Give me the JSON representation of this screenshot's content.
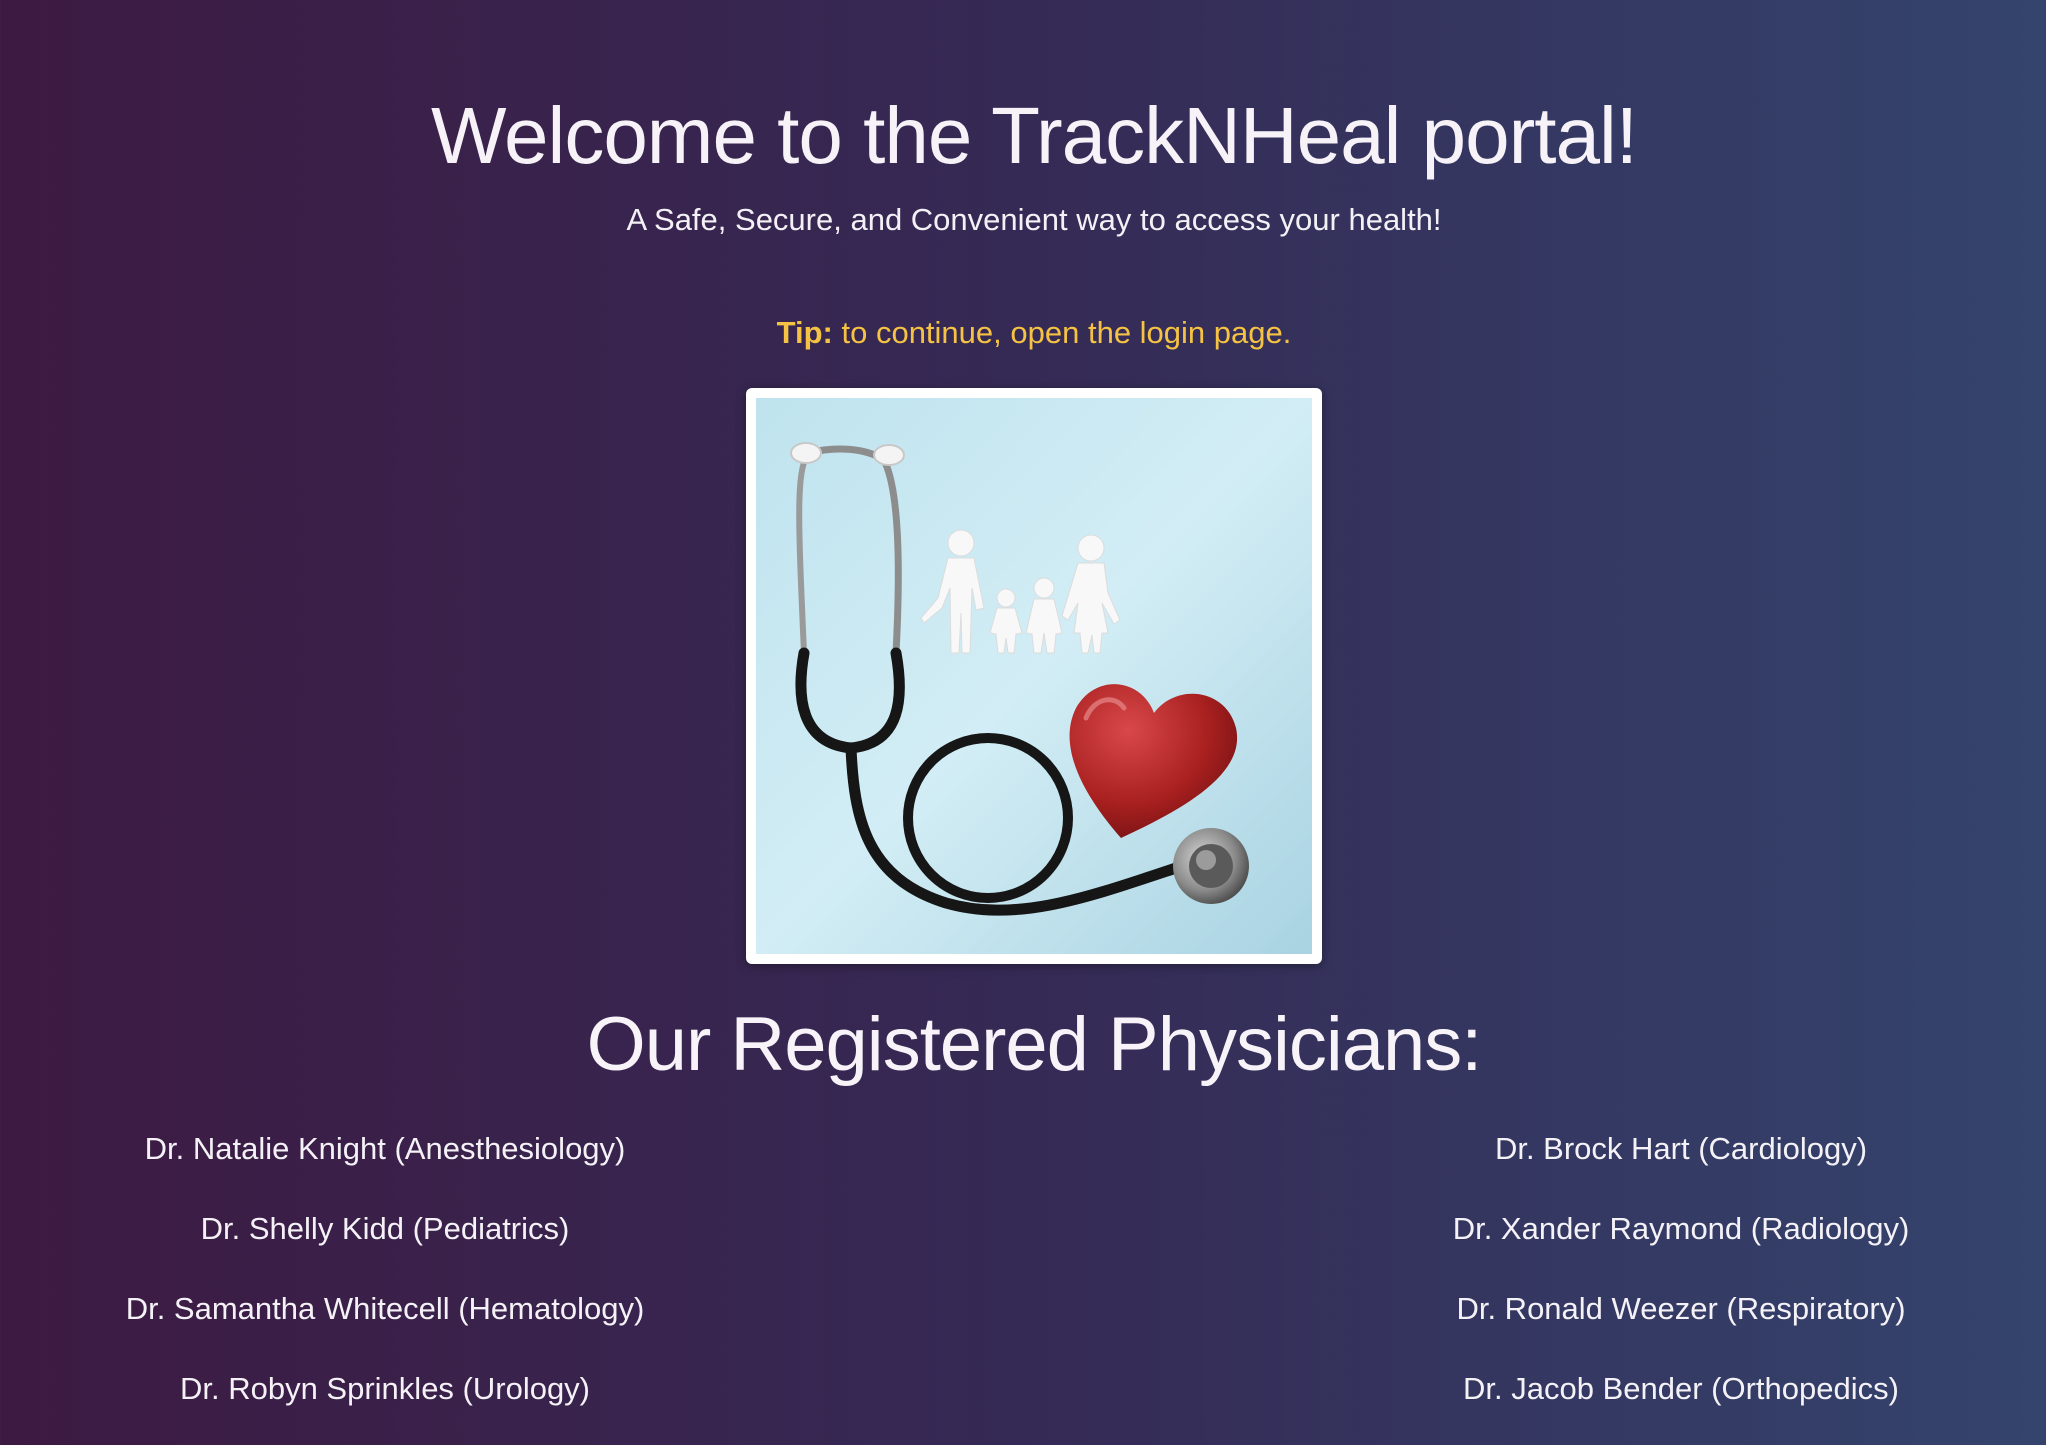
{
  "header": {
    "title": "Welcome to the TrackNHeal portal!",
    "subtitle": "A Safe, Secure, and Convenient way to access your health!",
    "tip_label": "Tip:",
    "tip_text": " to continue, open the login page."
  },
  "hero_image": {
    "icon": "stethoscope-heart-family-image"
  },
  "physicians": {
    "heading": "Our Registered Physicians:",
    "left": [
      {
        "name": "Dr. Natalie Knight (Anesthesiology)"
      },
      {
        "name": "Dr. Shelly Kidd (Pediatrics)"
      },
      {
        "name": "Dr. Samantha Whitecell (Hematology)"
      },
      {
        "name": "Dr. Robyn Sprinkles (Urology)"
      }
    ],
    "right": [
      {
        "name": "Dr. Brock Hart (Cardiology)"
      },
      {
        "name": "Dr. Xander Raymond (Radiology)"
      },
      {
        "name": "Dr. Ronald Weezer (Respiratory)"
      },
      {
        "name": "Dr. Jacob Bender (Orthopedics)"
      }
    ]
  },
  "colors": {
    "background_start": "#3d1a42",
    "background_end": "#34446d",
    "tip": "#f5c243",
    "heart": "#b3262a"
  }
}
